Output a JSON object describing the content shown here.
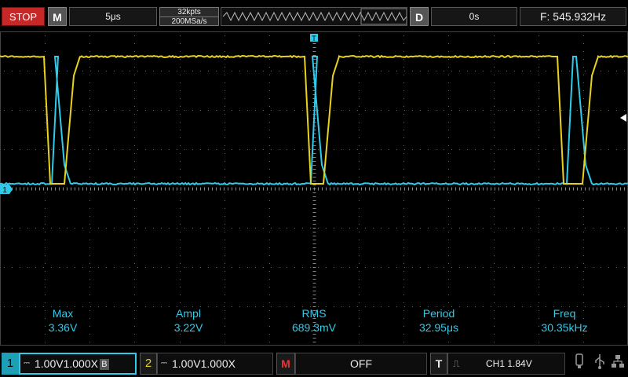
{
  "topbar": {
    "run_state": "STOP",
    "menu_label": "M",
    "timebase": "5μs",
    "memory_depth": "32kpts",
    "sample_rate": "200MSa/s",
    "delay_label": "D",
    "trigger_position": "0s",
    "frequency": "F: 545.932Hz"
  },
  "markers": {
    "trigger_marker": "T",
    "ch1_marker": "1"
  },
  "measurements": [
    {
      "name": "Max",
      "value": "3.36V"
    },
    {
      "name": "Ampl",
      "value": "3.22V"
    },
    {
      "name": "RMS",
      "value": "689.3mV"
    },
    {
      "name": "Period",
      "value": "32.95μs"
    },
    {
      "name": "Freq",
      "value": "30.35kHz"
    }
  ],
  "bottombar": {
    "ch1": {
      "number": "1",
      "scale": "1.00V",
      "probe": "1.000X",
      "bw_label": "B"
    },
    "ch2": {
      "number": "2",
      "scale": "1.00V",
      "probe": "1.000X"
    },
    "math": {
      "label": "M",
      "state": "OFF"
    },
    "trigger": {
      "label": "T",
      "source_level": "CH1 1.84V"
    }
  },
  "colors": {
    "ch1": "#2ecbea",
    "ch2": "#e8d21c",
    "stop": "#c62828"
  },
  "icons": [
    "usb-icon",
    "network-icon",
    "trigger-rising-edge-icon"
  ]
}
